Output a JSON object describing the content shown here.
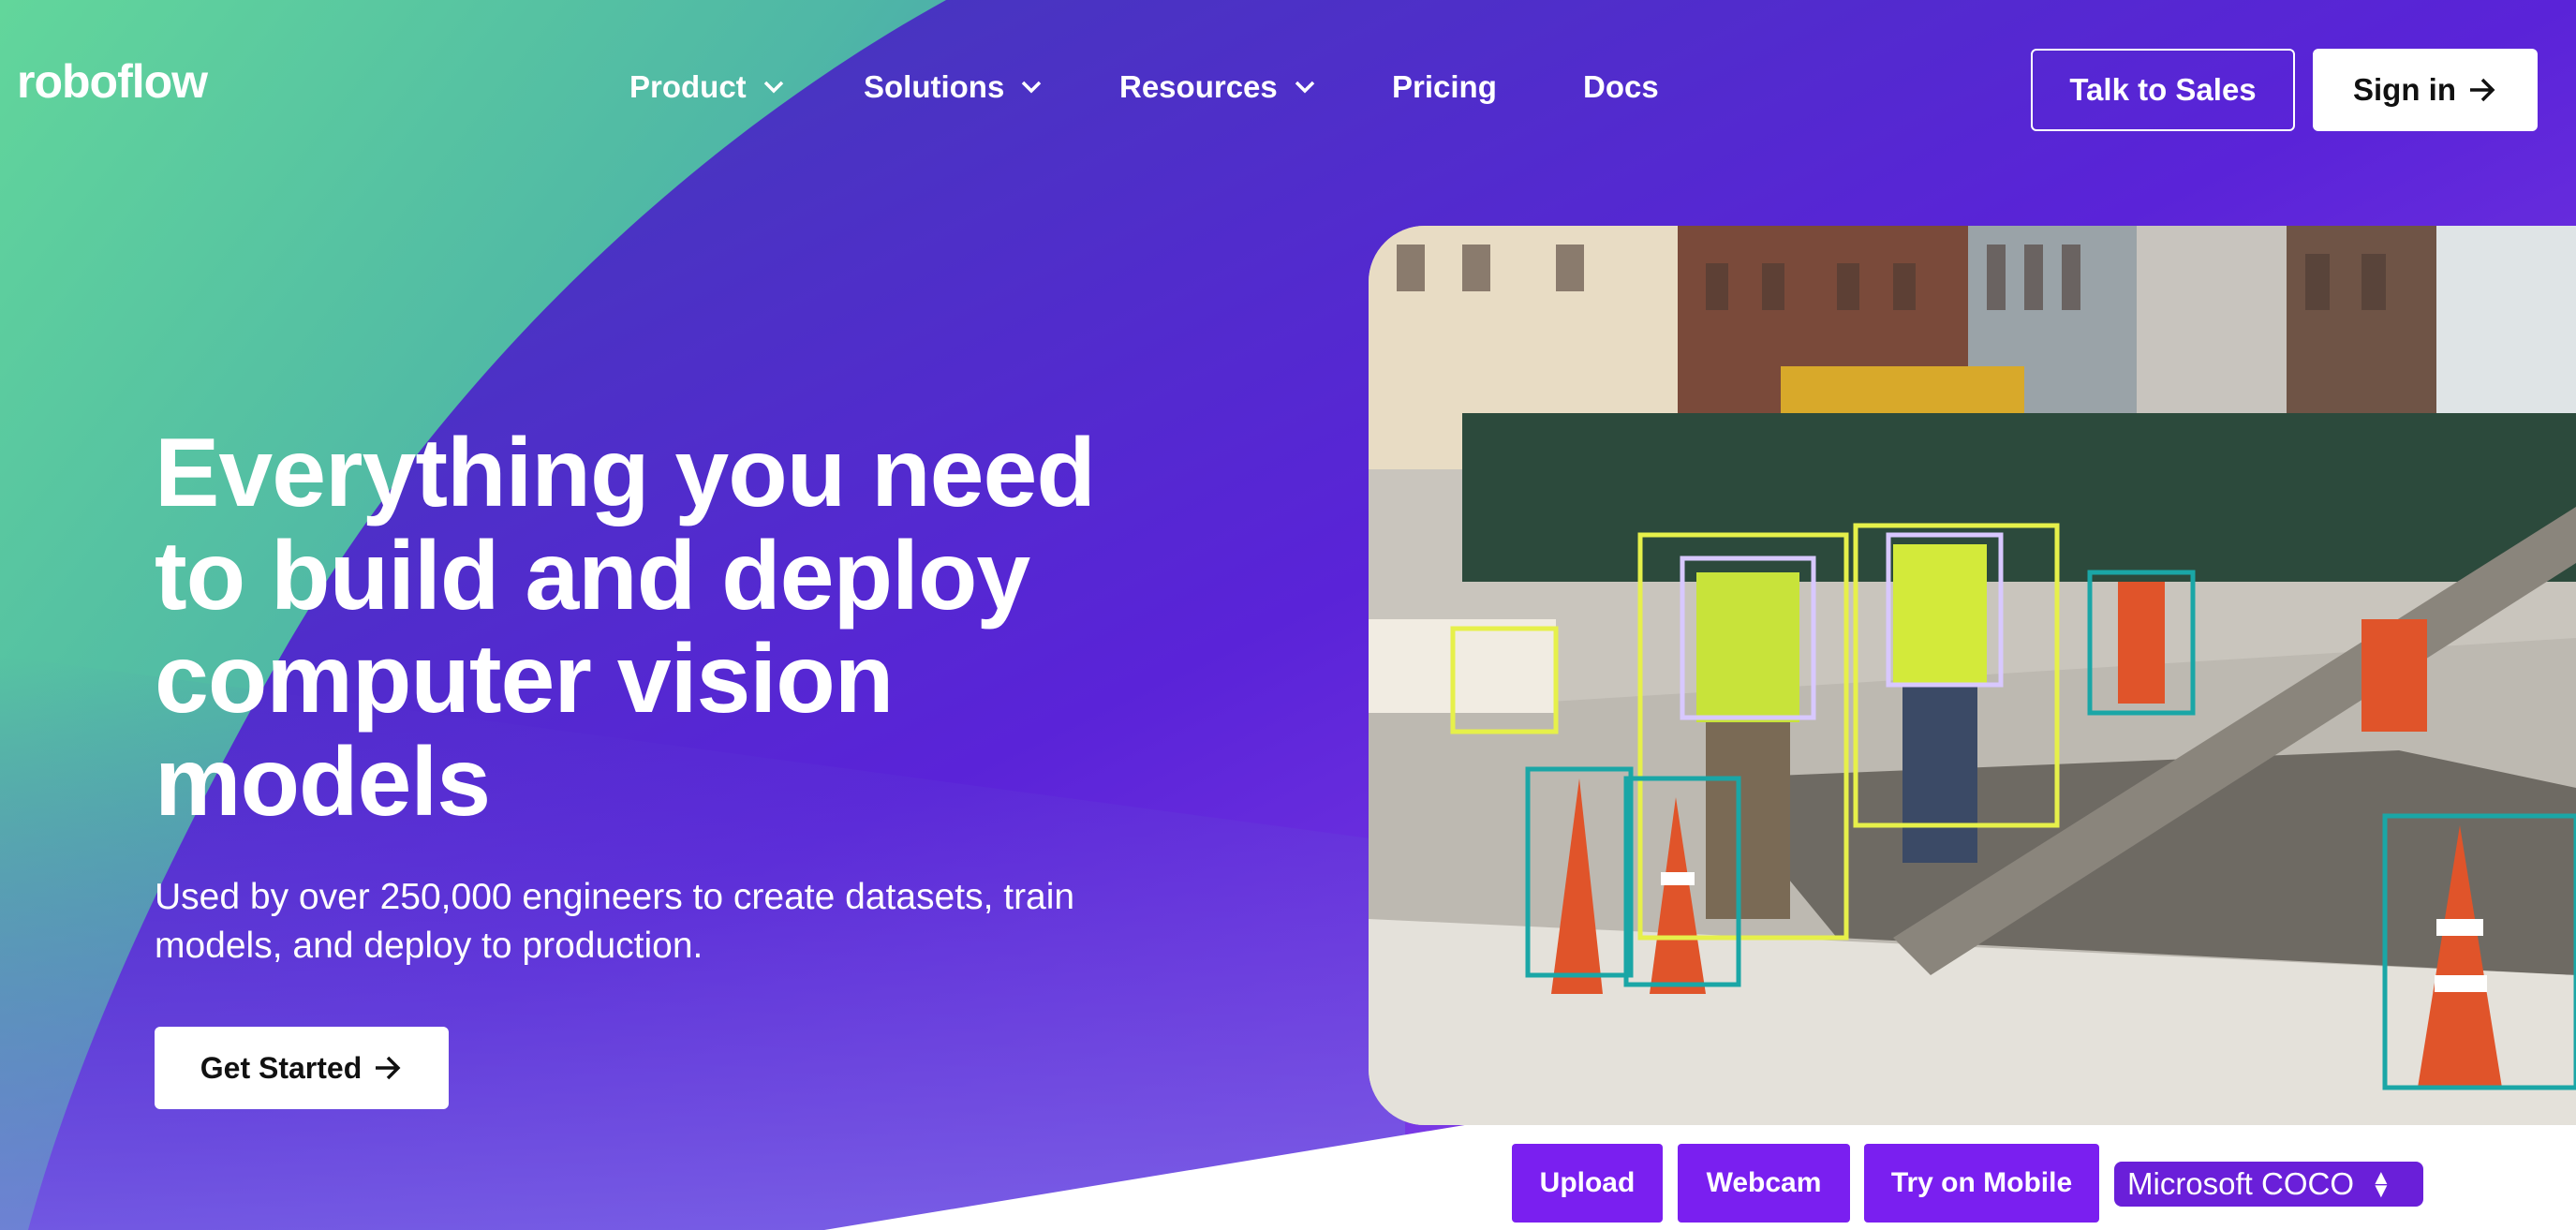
{
  "brand": {
    "logo_text": "roboflow"
  },
  "nav": {
    "items": [
      {
        "label": "Product",
        "has_dropdown": true
      },
      {
        "label": "Solutions",
        "has_dropdown": true
      },
      {
        "label": "Resources",
        "has_dropdown": true
      },
      {
        "label": "Pricing",
        "has_dropdown": false
      },
      {
        "label": "Docs",
        "has_dropdown": false
      }
    ],
    "talk_to_sales": "Talk to Sales",
    "sign_in": "Sign in"
  },
  "hero": {
    "headline_lines": [
      "Everything you need",
      "to build and deploy",
      "computer vision",
      "models"
    ],
    "subline_lines": [
      "Used by over 250,000 engineers to create datasets, train",
      "models, and deploy to production."
    ],
    "cta_label": "Get Started"
  },
  "demo": {
    "buttons": [
      "Upload",
      "Webcam",
      "Try on Mobile"
    ],
    "model_select": {
      "selected": "Microsoft COCO"
    }
  },
  "colors": {
    "accent_purple": "#7a1ff0",
    "gradient_green": "#5fd79a",
    "hero_purple": "#4a22c9",
    "bbox_yellow": "#e6f04a",
    "bbox_lavender": "#d8c8ff",
    "bbox_teal": "#1aa6a6"
  },
  "icons": {
    "dropdown": "chevron-down-icon",
    "arrow": "arrow-right-icon",
    "select": "updown-arrows-icon"
  }
}
